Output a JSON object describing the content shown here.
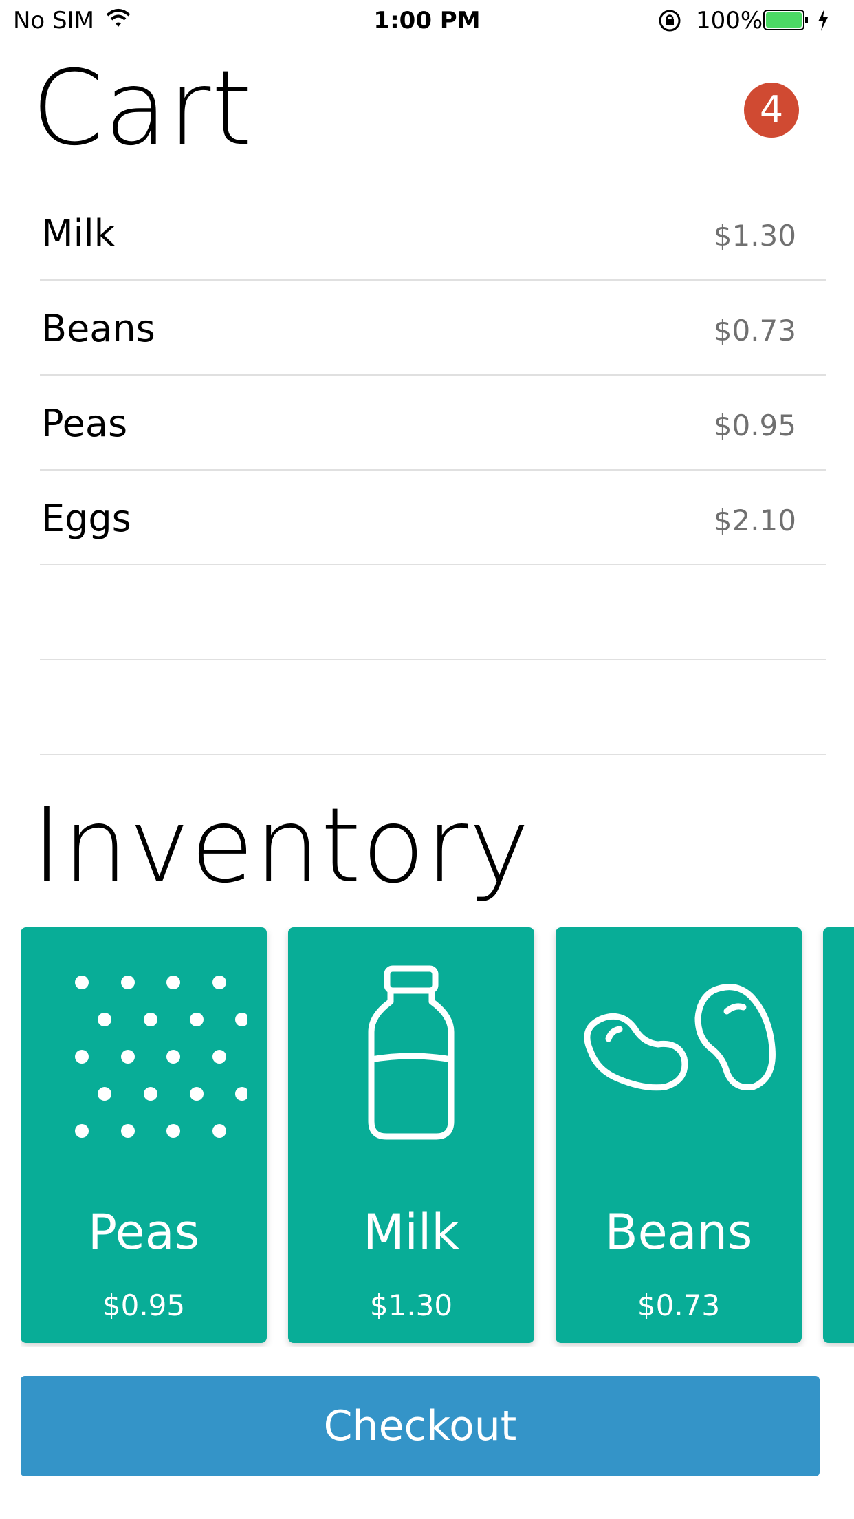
{
  "status_bar": {
    "carrier": "No SIM",
    "time": "1:00 PM",
    "battery": "100%"
  },
  "cart": {
    "title": "Cart",
    "badge_count": "4",
    "items": [
      {
        "name": "Milk",
        "price": "$1.30"
      },
      {
        "name": "Beans",
        "price": "$0.73"
      },
      {
        "name": "Peas",
        "price": "$0.95"
      },
      {
        "name": "Eggs",
        "price": "$2.10"
      },
      {
        "name": "",
        "price": ""
      },
      {
        "name": "",
        "price": ""
      }
    ]
  },
  "inventory": {
    "title": "Inventory",
    "items": [
      {
        "name": "Peas",
        "price": "$0.95",
        "icon": "peas-icon"
      },
      {
        "name": "Milk",
        "price": "$1.30",
        "icon": "milk-bottle-icon"
      },
      {
        "name": "Beans",
        "price": "$0.73",
        "icon": "beans-icon"
      }
    ]
  },
  "checkout": {
    "label": "Checkout"
  },
  "colors": {
    "card": "#08ad97",
    "badge": "#d04a32",
    "checkout": "#3494c8"
  }
}
